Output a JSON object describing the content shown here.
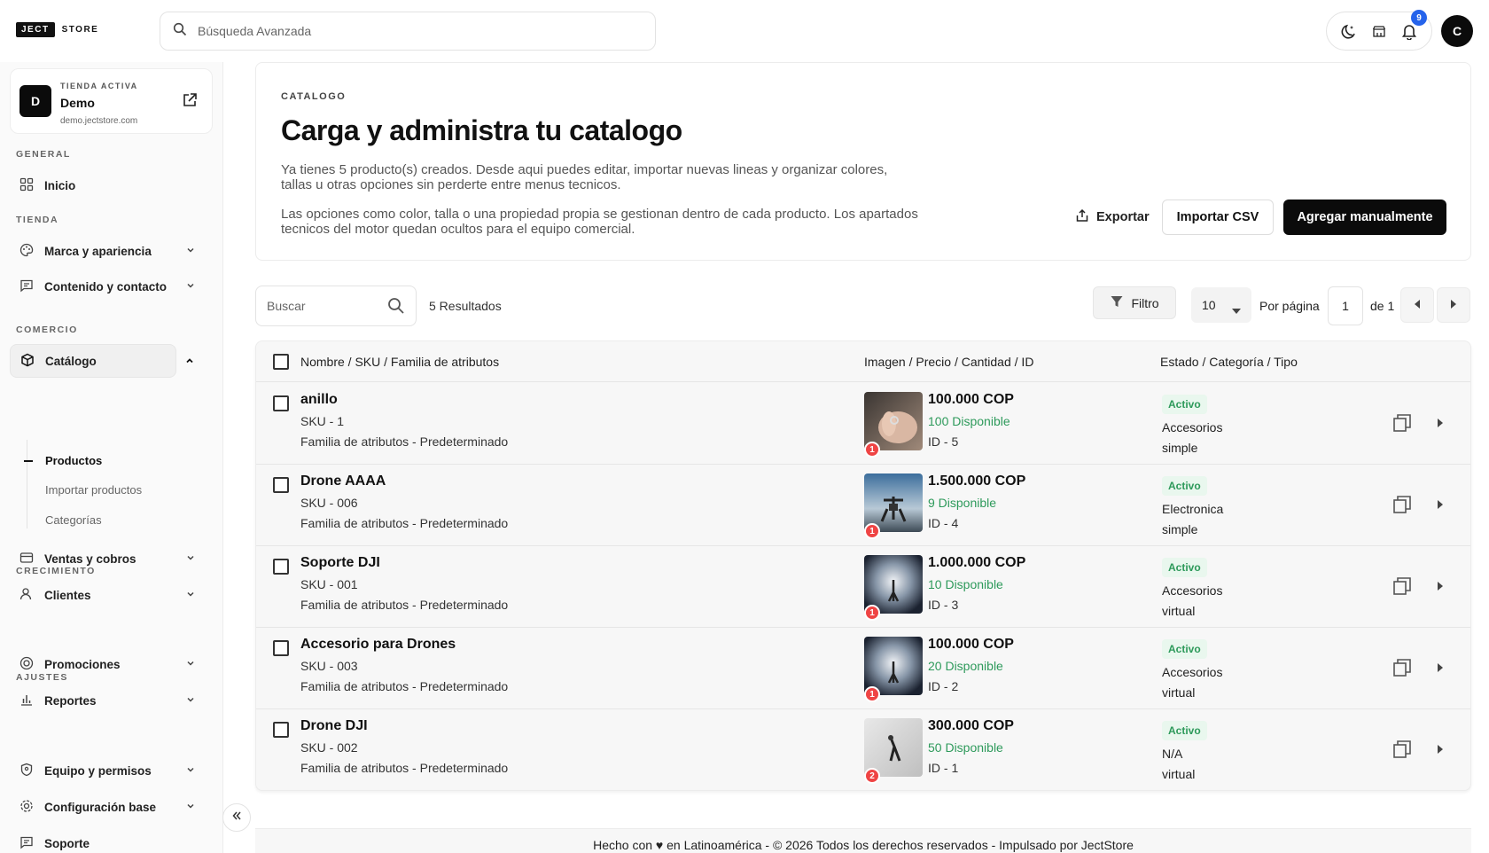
{
  "brand": {
    "logo_box": "JECT",
    "logo_text": "STORE"
  },
  "top_search": {
    "placeholder": "Búsqueda Avanzada"
  },
  "notifications": {
    "count": "9"
  },
  "user": {
    "initial": "C"
  },
  "store": {
    "initial": "D",
    "kicker": "TIENDA ACTIVA",
    "name": "Demo",
    "url": "demo.jectstore.com"
  },
  "sidebar": {
    "sections": {
      "general": "GENERAL",
      "tienda": "TIENDA",
      "comercio": "COMERCIO",
      "crecimiento": "CRECIMIENTO",
      "ajustes": "AJUSTES"
    },
    "items": {
      "inicio": "Inicio",
      "marca": "Marca y apariencia",
      "contenido": "Contenido y contacto",
      "catalogo": "Catálogo",
      "ventas": "Ventas y cobros",
      "clientes": "Clientes",
      "promociones": "Promociones",
      "reportes": "Reportes",
      "equipo": "Equipo y permisos",
      "config": "Configuración base",
      "soporte": "Soporte"
    },
    "catalog_sub": {
      "productos": "Productos",
      "importar": "Importar productos",
      "categorias": "Categorías"
    }
  },
  "hero": {
    "kicker": "CATALOGO",
    "title": "Carga y administra tu catalogo",
    "p1": "Ya tienes 5 producto(s) creados. Desde aqui puedes editar, importar nuevas lineas y organizar colores, tallas u otras opciones sin perderte entre menus tecnicos.",
    "p2": "Las opciones como color, talla o una propiedad propia se gestionan dentro de cada producto. Los apartados tecnicos del motor quedan ocultos para el equipo comercial.",
    "export_label": "Exportar",
    "import_label": "Importar CSV",
    "add_label": "Agregar manualmente"
  },
  "toolbar": {
    "search_placeholder": "Buscar",
    "results": "5 Resultados",
    "filter_label": "Filtro",
    "per_page_value": "10",
    "per_page_label": "Por página",
    "page": "1",
    "page_of": "de 1"
  },
  "table": {
    "headers": {
      "col1": "Nombre / SKU / Familia de atributos",
      "col2": "Imagen / Precio / Cantidad / ID",
      "col3": "Estado / Categoría / Tipo"
    },
    "rows": [
      {
        "name": "anillo",
        "sku": "SKU - 1",
        "family": "Familia de atributos - Predeterminado",
        "badge": "1",
        "price": "100.000 COP",
        "stock": "100 Disponible",
        "id": "ID - 5",
        "status": "Activo",
        "category": "Accesorios",
        "type": "simple"
      },
      {
        "name": "Drone AAAA",
        "sku": "SKU - 006",
        "family": "Familia de atributos - Predeterminado",
        "badge": "1",
        "price": "1.500.000 COP",
        "stock": "9 Disponible",
        "id": "ID - 4",
        "status": "Activo",
        "category": "Electronica",
        "type": "simple"
      },
      {
        "name": "Soporte DJI",
        "sku": "SKU - 001",
        "family": "Familia de atributos - Predeterminado",
        "badge": "1",
        "price": "1.000.000 COP",
        "stock": "10 Disponible",
        "id": "ID - 3",
        "status": "Activo",
        "category": "Accesorios",
        "type": "virtual"
      },
      {
        "name": "Accesorio para Drones",
        "sku": "SKU - 003",
        "family": "Familia de atributos - Predeterminado",
        "badge": "1",
        "price": "100.000 COP",
        "stock": "20 Disponible",
        "id": "ID - 2",
        "status": "Activo",
        "category": "Accesorios",
        "type": "virtual"
      },
      {
        "name": "Drone DJI",
        "sku": "SKU - 002",
        "family": "Familia de atributos - Predeterminado",
        "badge": "2",
        "price": "300.000 COP",
        "stock": "50 Disponible",
        "id": "ID - 1",
        "status": "Activo",
        "category": "N/A",
        "type": "virtual"
      }
    ]
  },
  "footer": {
    "text": "Hecho con ♥ en Latinoamérica - © 2026 Todos los derechos reservados - Impulsado por JectStore"
  },
  "colors": {
    "accent": "#0b0b0b",
    "success": "#2e9a5b",
    "badge_blue": "#2563eb",
    "badge_red": "#ef4444"
  }
}
